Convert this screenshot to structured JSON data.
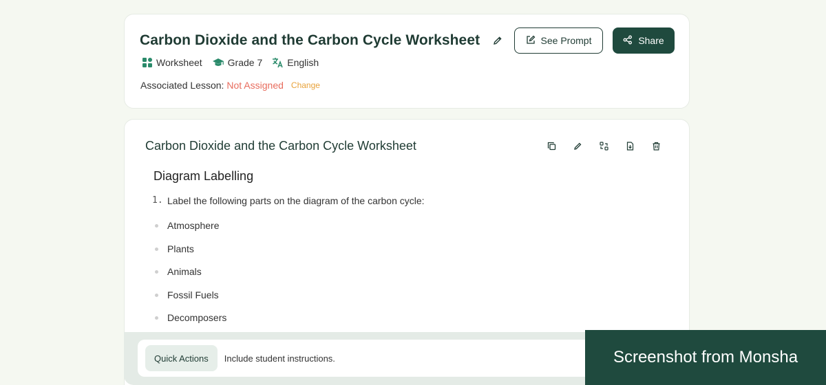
{
  "header": {
    "title": "Carbon Dioxide and the Carbon Cycle Worksheet",
    "meta": {
      "type": "Worksheet",
      "grade": "Grade 7",
      "language": "English"
    },
    "lesson_label": "Associated Lesson:",
    "lesson_value": "Not Assigned",
    "change_label": "Change",
    "see_prompt_label": "See Prompt",
    "share_label": "Share"
  },
  "document": {
    "title": "Carbon Dioxide and the Carbon Cycle Worksheet",
    "tools": [
      "copy-icon",
      "edit-icon",
      "convert-icon",
      "export-icon",
      "delete-icon"
    ],
    "section_heading": "Diagram Labelling",
    "question_number": "1.",
    "question_text": "Label the following parts on the diagram of the carbon cycle:",
    "items": [
      "Atmosphere",
      "Plants",
      "Animals",
      "Fossil Fuels",
      "Decomposers"
    ]
  },
  "quick_actions": {
    "chip_label": "Quick Actions",
    "input_text": "Include student instructions."
  },
  "watermark": "Screenshot from Monsha",
  "colors": {
    "brand": "#1f4a3e",
    "warning": "#e86c5d",
    "accent": "#e8a23a",
    "background": "#f5f8f1"
  }
}
